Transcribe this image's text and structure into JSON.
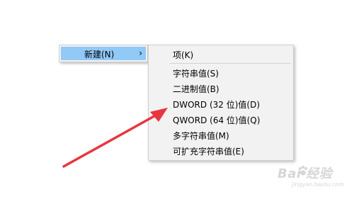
{
  "parent_menu": {
    "new_label": "新建(N)",
    "chevron": "›",
    "chevron_icon": "chevron-right-icon",
    "highlight_color": "#91c9f7"
  },
  "submenu": {
    "items": [
      {
        "label": "项(K)"
      },
      {
        "label": "字符串值(S)"
      },
      {
        "label": "二进制值(B)"
      },
      {
        "label": "DWORD (32 位)值(D)"
      },
      {
        "label": "QWORD (64 位)值(Q)"
      },
      {
        "label": "多字符串值(M)"
      },
      {
        "label": "可扩充字符串值(E)"
      }
    ]
  },
  "annotation": {
    "arrow_color": "#e8363f"
  },
  "watermark": {
    "brand": "Bai  经验",
    "url": "jingyan.baidu.com"
  }
}
